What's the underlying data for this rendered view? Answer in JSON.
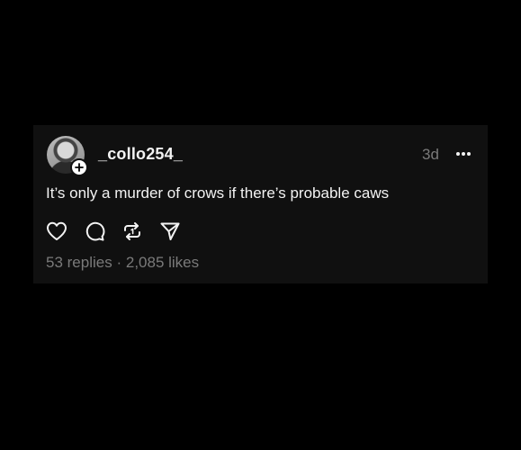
{
  "post": {
    "username": "_collo254_",
    "timestamp": "3d",
    "text": "It’s only a murder of crows if there’s probable caws",
    "replies": "53 replies",
    "separator": "·",
    "likes": "2,085 likes"
  },
  "icons": {
    "more": "more-horizontal-icon",
    "like": "heart-icon",
    "reply": "comment-icon",
    "repost": "repost-icon",
    "share": "send-icon",
    "follow": "plus-icon"
  },
  "colors": {
    "background": "#000000",
    "card": "#101010",
    "text_primary": "#f3f3f3",
    "text_secondary": "#7a7a7a"
  }
}
